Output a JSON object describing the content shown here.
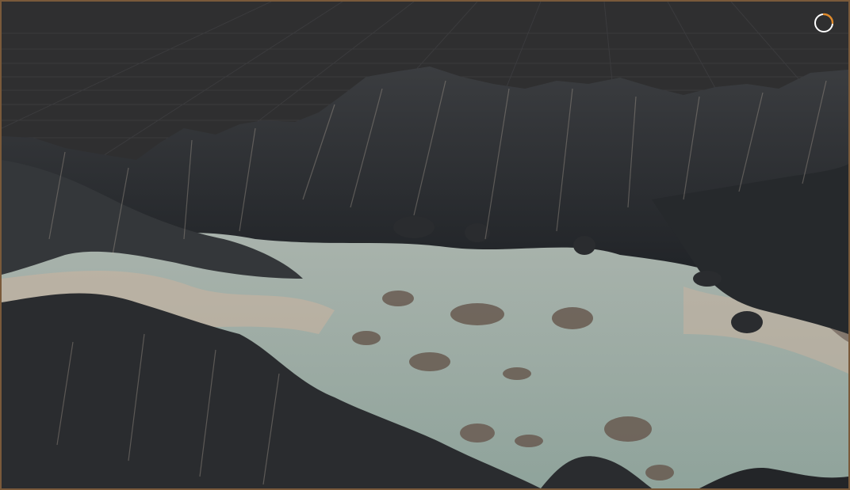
{
  "viewport": {
    "frame_color": "#7a5a3a",
    "background_color": "#2f2f30",
    "grid_color": "#3a3a3c"
  },
  "terrain": {
    "rock_dark": "#1f2226",
    "rock_mid": "#4a4a4c",
    "rock_light": "#b9ad9f",
    "valley_floor": "#9fb0a8",
    "sand": "#c8b3a0"
  },
  "spinner": {
    "icon": "loading-spinner-icon",
    "ring_color": "#ffffff",
    "accent_color": "#e08a2a"
  }
}
